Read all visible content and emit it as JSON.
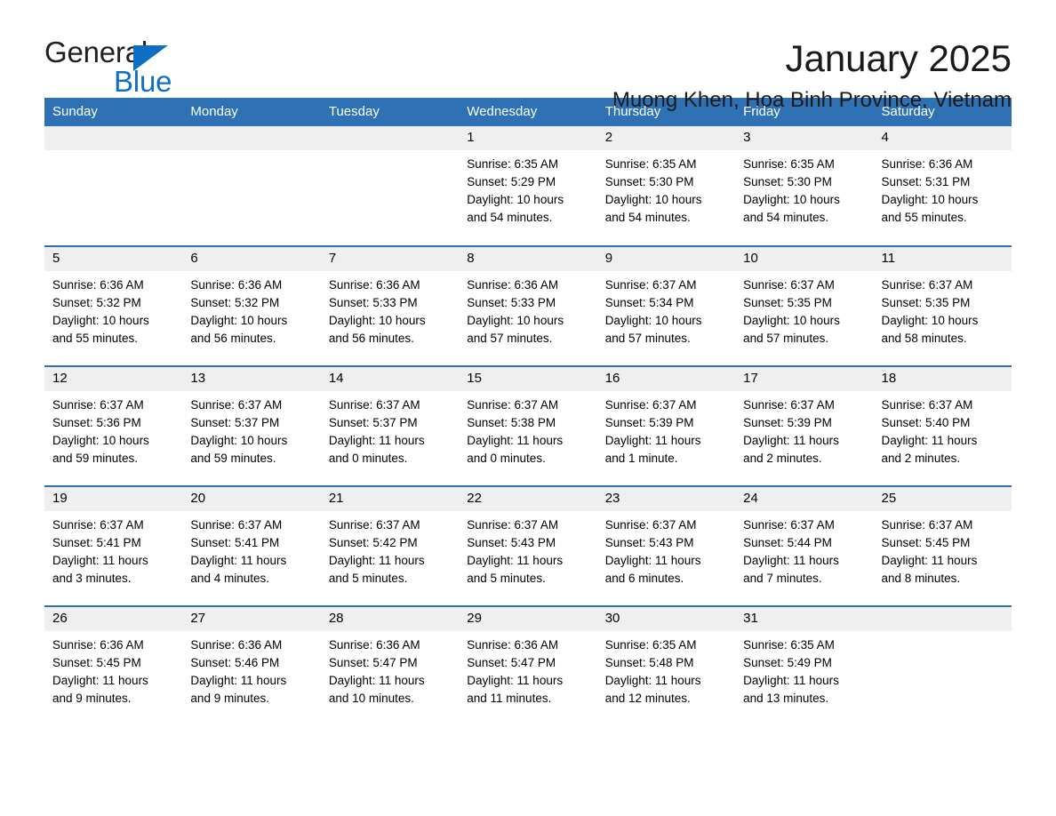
{
  "brand": {
    "name_part1": "General",
    "name_part2": "Blue",
    "accent_color": "#0f6fc5"
  },
  "header": {
    "month_title": "January 2025",
    "location": "Muong Khen, Hoa Binh Province, Vietnam",
    "header_bg_color": "#2e71b5",
    "daynum_bg_color": "#efefef"
  },
  "calendar": {
    "weekdays": [
      "Sunday",
      "Monday",
      "Tuesday",
      "Wednesday",
      "Thursday",
      "Friday",
      "Saturday"
    ],
    "weeks": [
      [
        {
          "day": "",
          "empty": true
        },
        {
          "day": "",
          "empty": true
        },
        {
          "day": "",
          "empty": true
        },
        {
          "day": "1",
          "sunrise": "Sunrise: 6:35 AM",
          "sunset": "Sunset: 5:29 PM",
          "daylight1": "Daylight: 10 hours",
          "daylight2": "and 54 minutes."
        },
        {
          "day": "2",
          "sunrise": "Sunrise: 6:35 AM",
          "sunset": "Sunset: 5:30 PM",
          "daylight1": "Daylight: 10 hours",
          "daylight2": "and 54 minutes."
        },
        {
          "day": "3",
          "sunrise": "Sunrise: 6:35 AM",
          "sunset": "Sunset: 5:30 PM",
          "daylight1": "Daylight: 10 hours",
          "daylight2": "and 54 minutes."
        },
        {
          "day": "4",
          "sunrise": "Sunrise: 6:36 AM",
          "sunset": "Sunset: 5:31 PM",
          "daylight1": "Daylight: 10 hours",
          "daylight2": "and 55 minutes."
        }
      ],
      [
        {
          "day": "5",
          "sunrise": "Sunrise: 6:36 AM",
          "sunset": "Sunset: 5:32 PM",
          "daylight1": "Daylight: 10 hours",
          "daylight2": "and 55 minutes."
        },
        {
          "day": "6",
          "sunrise": "Sunrise: 6:36 AM",
          "sunset": "Sunset: 5:32 PM",
          "daylight1": "Daylight: 10 hours",
          "daylight2": "and 56 minutes."
        },
        {
          "day": "7",
          "sunrise": "Sunrise: 6:36 AM",
          "sunset": "Sunset: 5:33 PM",
          "daylight1": "Daylight: 10 hours",
          "daylight2": "and 56 minutes."
        },
        {
          "day": "8",
          "sunrise": "Sunrise: 6:36 AM",
          "sunset": "Sunset: 5:33 PM",
          "daylight1": "Daylight: 10 hours",
          "daylight2": "and 57 minutes."
        },
        {
          "day": "9",
          "sunrise": "Sunrise: 6:37 AM",
          "sunset": "Sunset: 5:34 PM",
          "daylight1": "Daylight: 10 hours",
          "daylight2": "and 57 minutes."
        },
        {
          "day": "10",
          "sunrise": "Sunrise: 6:37 AM",
          "sunset": "Sunset: 5:35 PM",
          "daylight1": "Daylight: 10 hours",
          "daylight2": "and 57 minutes."
        },
        {
          "day": "11",
          "sunrise": "Sunrise: 6:37 AM",
          "sunset": "Sunset: 5:35 PM",
          "daylight1": "Daylight: 10 hours",
          "daylight2": "and 58 minutes."
        }
      ],
      [
        {
          "day": "12",
          "sunrise": "Sunrise: 6:37 AM",
          "sunset": "Sunset: 5:36 PM",
          "daylight1": "Daylight: 10 hours",
          "daylight2": "and 59 minutes."
        },
        {
          "day": "13",
          "sunrise": "Sunrise: 6:37 AM",
          "sunset": "Sunset: 5:37 PM",
          "daylight1": "Daylight: 10 hours",
          "daylight2": "and 59 minutes."
        },
        {
          "day": "14",
          "sunrise": "Sunrise: 6:37 AM",
          "sunset": "Sunset: 5:37 PM",
          "daylight1": "Daylight: 11 hours",
          "daylight2": "and 0 minutes."
        },
        {
          "day": "15",
          "sunrise": "Sunrise: 6:37 AM",
          "sunset": "Sunset: 5:38 PM",
          "daylight1": "Daylight: 11 hours",
          "daylight2": "and 0 minutes."
        },
        {
          "day": "16",
          "sunrise": "Sunrise: 6:37 AM",
          "sunset": "Sunset: 5:39 PM",
          "daylight1": "Daylight: 11 hours",
          "daylight2": "and 1 minute."
        },
        {
          "day": "17",
          "sunrise": "Sunrise: 6:37 AM",
          "sunset": "Sunset: 5:39 PM",
          "daylight1": "Daylight: 11 hours",
          "daylight2": "and 2 minutes."
        },
        {
          "day": "18",
          "sunrise": "Sunrise: 6:37 AM",
          "sunset": "Sunset: 5:40 PM",
          "daylight1": "Daylight: 11 hours",
          "daylight2": "and 2 minutes."
        }
      ],
      [
        {
          "day": "19",
          "sunrise": "Sunrise: 6:37 AM",
          "sunset": "Sunset: 5:41 PM",
          "daylight1": "Daylight: 11 hours",
          "daylight2": "and 3 minutes."
        },
        {
          "day": "20",
          "sunrise": "Sunrise: 6:37 AM",
          "sunset": "Sunset: 5:41 PM",
          "daylight1": "Daylight: 11 hours",
          "daylight2": "and 4 minutes."
        },
        {
          "day": "21",
          "sunrise": "Sunrise: 6:37 AM",
          "sunset": "Sunset: 5:42 PM",
          "daylight1": "Daylight: 11 hours",
          "daylight2": "and 5 minutes."
        },
        {
          "day": "22",
          "sunrise": "Sunrise: 6:37 AM",
          "sunset": "Sunset: 5:43 PM",
          "daylight1": "Daylight: 11 hours",
          "daylight2": "and 5 minutes."
        },
        {
          "day": "23",
          "sunrise": "Sunrise: 6:37 AM",
          "sunset": "Sunset: 5:43 PM",
          "daylight1": "Daylight: 11 hours",
          "daylight2": "and 6 minutes."
        },
        {
          "day": "24",
          "sunrise": "Sunrise: 6:37 AM",
          "sunset": "Sunset: 5:44 PM",
          "daylight1": "Daylight: 11 hours",
          "daylight2": "and 7 minutes."
        },
        {
          "day": "25",
          "sunrise": "Sunrise: 6:37 AM",
          "sunset": "Sunset: 5:45 PM",
          "daylight1": "Daylight: 11 hours",
          "daylight2": "and 8 minutes."
        }
      ],
      [
        {
          "day": "26",
          "sunrise": "Sunrise: 6:36 AM",
          "sunset": "Sunset: 5:45 PM",
          "daylight1": "Daylight: 11 hours",
          "daylight2": "and 9 minutes."
        },
        {
          "day": "27",
          "sunrise": "Sunrise: 6:36 AM",
          "sunset": "Sunset: 5:46 PM",
          "daylight1": "Daylight: 11 hours",
          "daylight2": "and 9 minutes."
        },
        {
          "day": "28",
          "sunrise": "Sunrise: 6:36 AM",
          "sunset": "Sunset: 5:47 PM",
          "daylight1": "Daylight: 11 hours",
          "daylight2": "and 10 minutes."
        },
        {
          "day": "29",
          "sunrise": "Sunrise: 6:36 AM",
          "sunset": "Sunset: 5:47 PM",
          "daylight1": "Daylight: 11 hours",
          "daylight2": "and 11 minutes."
        },
        {
          "day": "30",
          "sunrise": "Sunrise: 6:35 AM",
          "sunset": "Sunset: 5:48 PM",
          "daylight1": "Daylight: 11 hours",
          "daylight2": "and 12 minutes."
        },
        {
          "day": "31",
          "sunrise": "Sunrise: 6:35 AM",
          "sunset": "Sunset: 5:49 PM",
          "daylight1": "Daylight: 11 hours",
          "daylight2": "and 13 minutes."
        },
        {
          "day": "",
          "empty": true
        }
      ]
    ]
  }
}
